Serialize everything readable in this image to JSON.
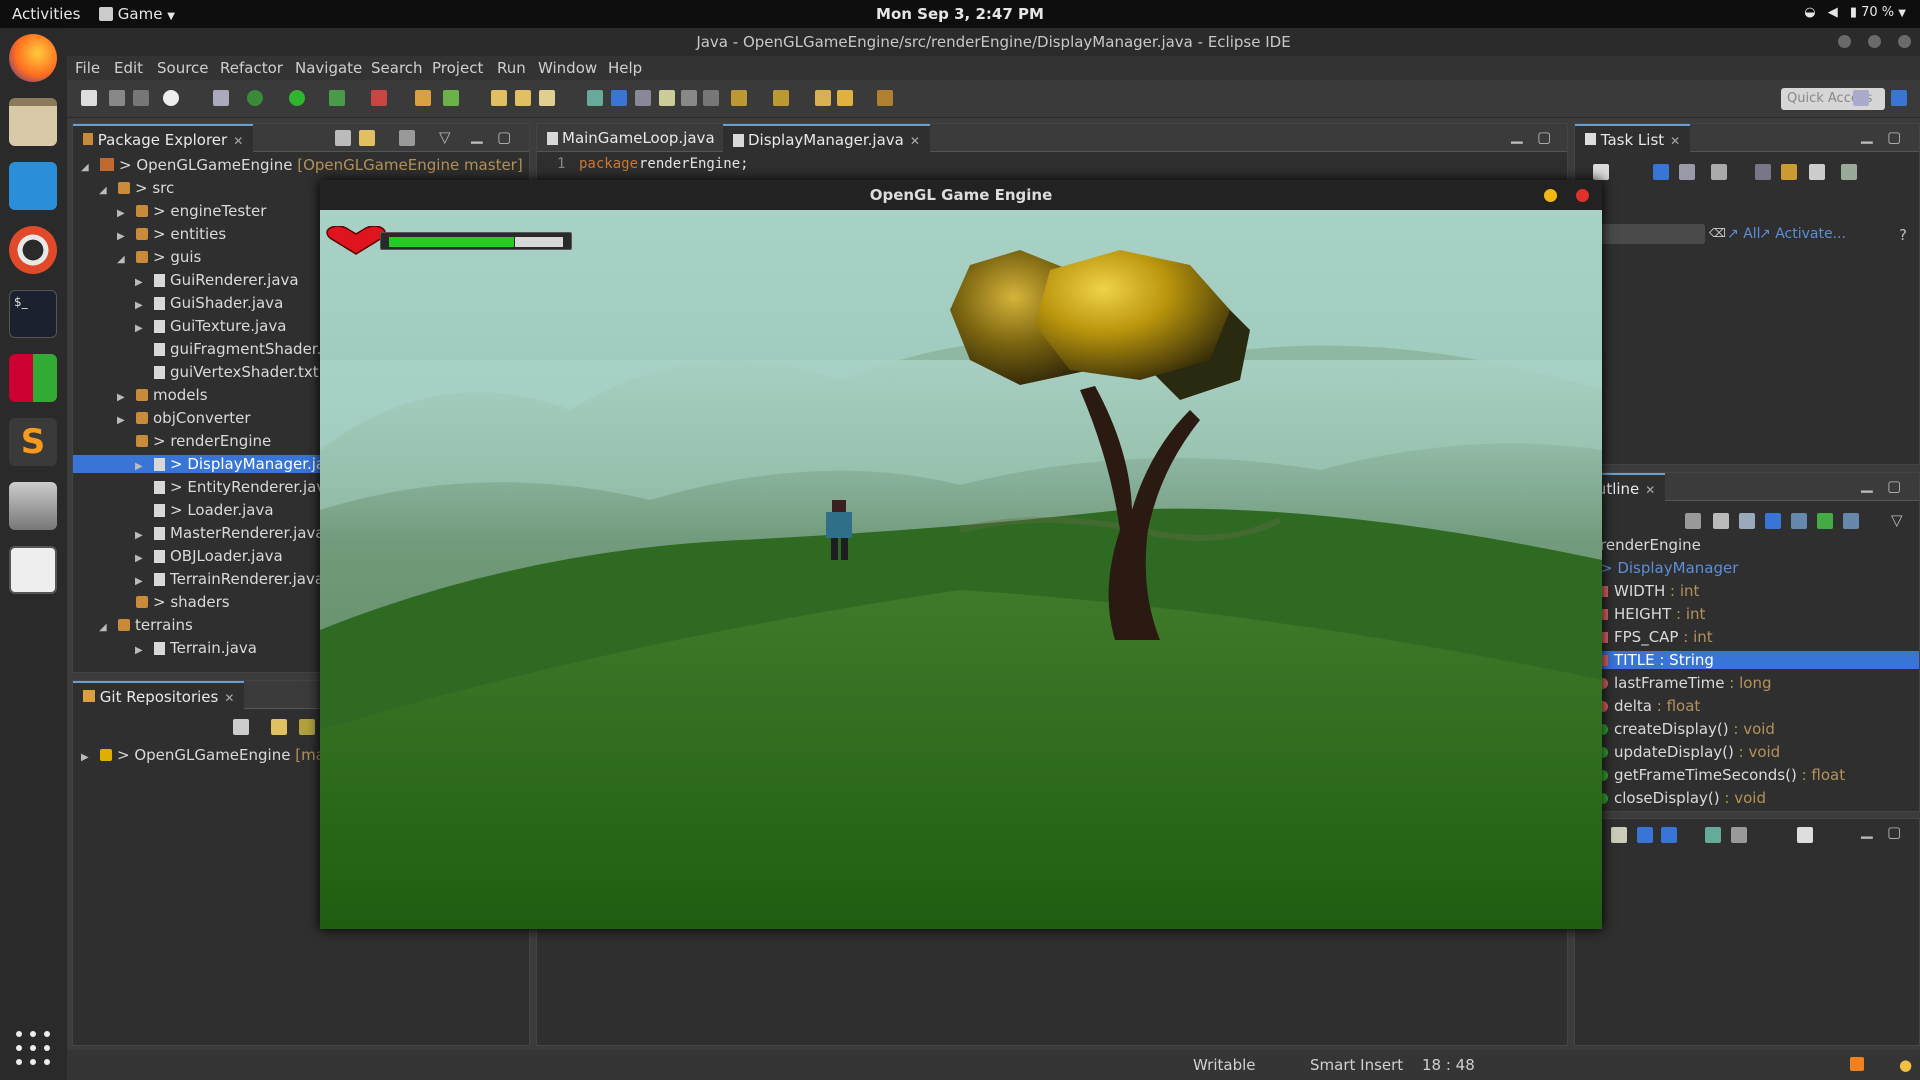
{
  "topbar": {
    "activities": "Activities",
    "app": "Game",
    "clock": "Mon Sep  3,  2:47 PM",
    "battery": "70 %"
  },
  "window": {
    "title": "Java - OpenGLGameEngine/src/renderEngine/DisplayManager.java - Eclipse IDE"
  },
  "menu": [
    "File",
    "Edit",
    "Source",
    "Refactor",
    "Navigate",
    "Search",
    "Project",
    "Run",
    "Window",
    "Help"
  ],
  "toolbar": {
    "quick_access": "Quick Access"
  },
  "package_explorer": {
    "tab": "Package Explorer",
    "items": [
      {
        "label": "> OpenGLGameEngine",
        "suffix": " [OpenGLGameEngine master]"
      },
      {
        "label": "> src"
      },
      {
        "label": "> engineTester"
      },
      {
        "label": "> entities"
      },
      {
        "label": "> guis"
      },
      {
        "label": "GuiRenderer.java"
      },
      {
        "label": "GuiShader.java"
      },
      {
        "label": "GuiTexture.java"
      },
      {
        "label": "guiFragmentShader.txt"
      },
      {
        "label": "guiVertexShader.txt"
      },
      {
        "label": "models"
      },
      {
        "label": "objConverter"
      },
      {
        "label": "> renderEngine"
      },
      {
        "label": "> DisplayManager.java"
      },
      {
        "label": "> EntityRenderer.java"
      },
      {
        "label": "> Loader.java"
      },
      {
        "label": "MasterRenderer.java"
      },
      {
        "label": "OBJLoader.java"
      },
      {
        "label": "TerrainRenderer.java"
      },
      {
        "label": "> shaders"
      },
      {
        "label": "terrains"
      },
      {
        "label": "Terrain.java"
      }
    ]
  },
  "git": {
    "tab": "Git Repositories",
    "repo": "> OpenGLGameEngine",
    "branch": " [master]"
  },
  "editor": {
    "tabs": [
      "MainGameLoop.java",
      "DisplayManager.java"
    ],
    "line_no": "1",
    "keyword": "package",
    "code": " renderEngine;"
  },
  "tasklist": {
    "tab": "Task List",
    "filter_all": "All",
    "filter_activate": "Activate..."
  },
  "outline": {
    "tab": "Outline",
    "package": "renderEngine",
    "class": "> DisplayManager",
    "members": [
      {
        "name": "WIDTH",
        "type": " : int"
      },
      {
        "name": "HEIGHT",
        "type": " : int"
      },
      {
        "name": "FPS_CAP",
        "type": " : int"
      },
      {
        "name": "TITLE",
        "type": " : String"
      },
      {
        "name": "lastFrameTime",
        "type": " : long"
      },
      {
        "name": "delta",
        "type": " : float"
      },
      {
        "name": "createDisplay()",
        "type": " : void"
      },
      {
        "name": "updateDisplay()",
        "type": " : void"
      },
      {
        "name": "getFrameTimeSeconds()",
        "type": " : float"
      },
      {
        "name": "closeDisplay()",
        "type": " : void"
      }
    ]
  },
  "game": {
    "title": "OpenGL Game Engine",
    "health": 0.72
  },
  "status": {
    "writable": "Writable",
    "insert": "Smart Insert",
    "position": "18 : 48"
  },
  "colors": {
    "selection": "#3875d7",
    "health": "#22cc22",
    "heart": "#e0141e"
  }
}
